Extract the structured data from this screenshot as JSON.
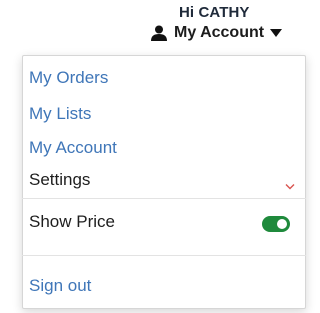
{
  "header": {
    "greeting": "Hi CATHY",
    "account_label": "My Account",
    "user_icon": "user-icon",
    "caret_icon": "caret-down-icon"
  },
  "menu": {
    "items": [
      {
        "label": "My Orders"
      },
      {
        "label": "My Lists"
      },
      {
        "label": "My Account"
      },
      {
        "label": "Settings",
        "icon": "chevron-down-icon"
      }
    ],
    "show_price": {
      "label": "Show Price",
      "enabled": true
    },
    "sign_out": "Sign out"
  },
  "colors": {
    "link": "#3f76b8",
    "dark_text": "#1e1e1e",
    "toggle_on": "#1f8a3c",
    "chevron": "#d9534f"
  }
}
